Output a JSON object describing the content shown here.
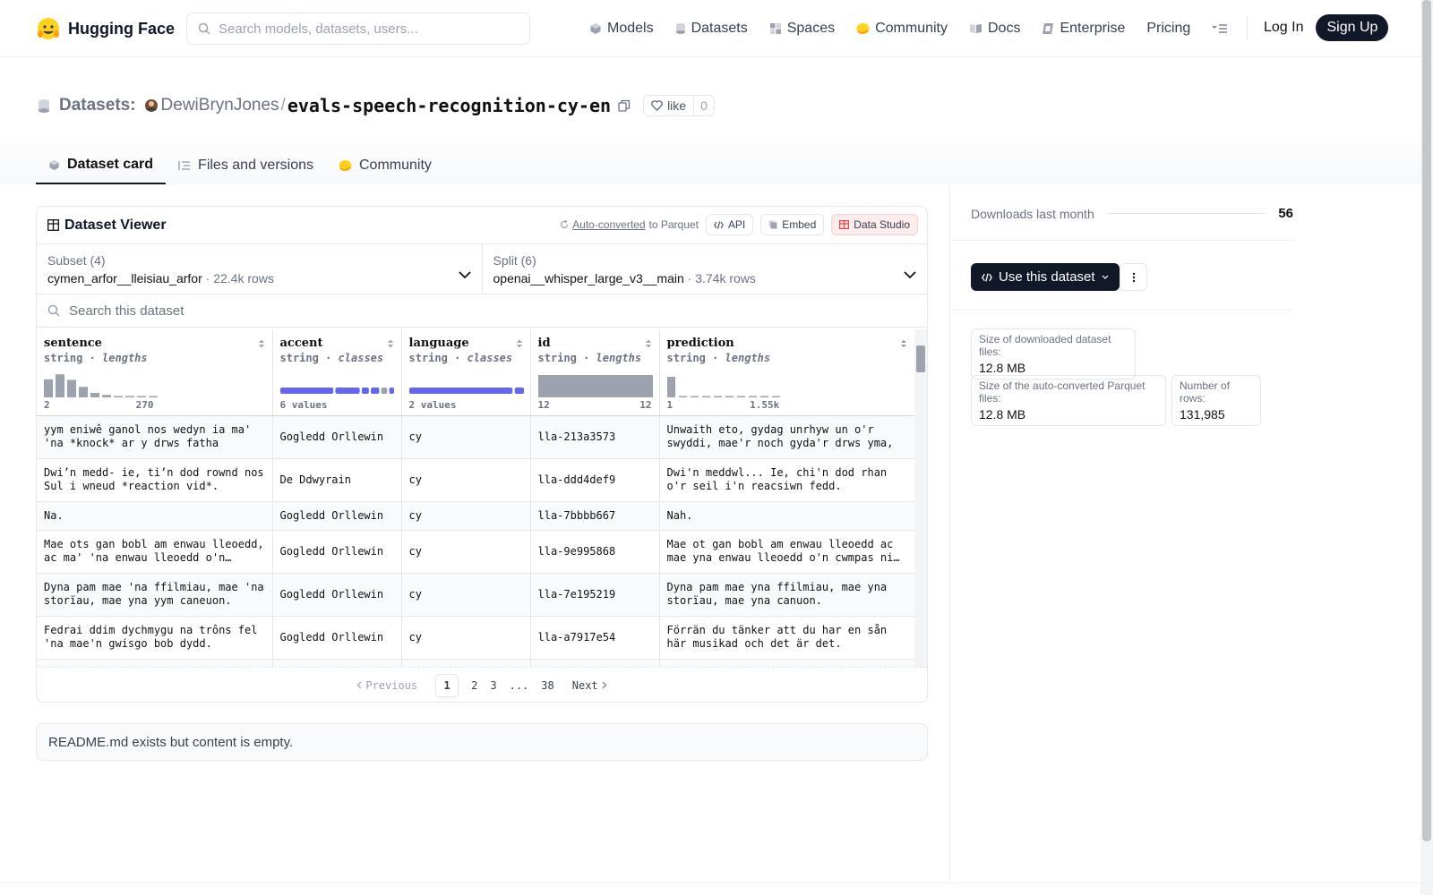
{
  "nav": {
    "brand": "Hugging Face",
    "search_placeholder": "Search models, datasets, users...",
    "links": [
      {
        "label": "Models",
        "icon": "models-icon"
      },
      {
        "label": "Datasets",
        "icon": "datasets-icon"
      },
      {
        "label": "Spaces",
        "icon": "spaces-icon"
      },
      {
        "label": "Community",
        "icon": "community-icon"
      },
      {
        "label": "Docs",
        "icon": "docs-icon"
      },
      {
        "label": "Enterprise",
        "icon": "enterprise-icon"
      },
      {
        "label": "Pricing",
        "icon": ""
      }
    ],
    "login": "Log In",
    "signup": "Sign Up"
  },
  "header": {
    "section": "Datasets:",
    "owner": "DewiBrynJones",
    "separator": "/",
    "repo": "evals-speech-recognition-cy-en",
    "like_label": "like",
    "like_count": "0",
    "tabs": [
      {
        "label": "Dataset card",
        "active": true
      },
      {
        "label": "Files and versions",
        "active": false
      },
      {
        "label": "Community",
        "active": false
      }
    ]
  },
  "viewer": {
    "title": "Dataset Viewer",
    "auto_converted": "Auto-converted",
    "to_parquet": "to Parquet",
    "api": "API",
    "embed": "Embed",
    "studio": "Data Studio",
    "subset_title": "Subset (4)",
    "subset_value": "cymen_arfor__lleisiau_arfor",
    "subset_rows": "22.4k rows",
    "split_title": "Split (6)",
    "split_value": "openai__whisper_large_v3__main",
    "split_rows": "3.74k rows",
    "search_placeholder": "Search this dataset",
    "columns": [
      {
        "name": "sentence",
        "type": "string",
        "kind": "lengths",
        "min": "2",
        "max": "270"
      },
      {
        "name": "accent",
        "type": "string",
        "kind": "classes",
        "summary": "6 values"
      },
      {
        "name": "language",
        "type": "string",
        "kind": "classes",
        "summary": "2 values"
      },
      {
        "name": "id",
        "type": "string",
        "kind": "lengths",
        "min": "12",
        "max": "12"
      },
      {
        "name": "prediction",
        "type": "string",
        "kind": "lengths",
        "min": "1",
        "max": "1.55k"
      }
    ],
    "rows": [
      [
        "yym eniwê ganol nos wedyn ia ma' 'na *knock* ar y drws fatha",
        "Gogledd Orllewin",
        "cy",
        "lla-213a3573",
        "Unwaith eto, gydag unrhyw un o'r swyddi, mae'r noch gyda'r drws yma,"
      ],
      [
        "Dwi’n medd- ie, ti’n dod rownd nos Sul i wneud *reaction vid*.",
        "De Ddwyrain",
        "cy",
        "lla-ddd4def9",
        "Dwi'n meddwl... Ie, chi'n dod rhan o'r seil i'n reacsiwn fedd."
      ],
      [
        "Na.",
        "Gogledd Orllewin",
        "cy",
        "lla-7bbbb667",
        "Nah."
      ],
      [
        "Mae ots gan bobl am enwau lleoedd, ac ma' 'na enwau lleoedd o'n cwmpas ni ym mhob man.",
        "Gogledd Orllewin",
        "cy",
        "lla-9e995868",
        "Mae ot gan bobl am enwau lleoedd ac mae yna enwau lleoedd o'n cwmpas ni ym mhob man."
      ],
      [
        "Dyna pam mae 'na ffilmiau, mae 'na storïau, mae yna yym caneuon.",
        "Gogledd Orllewin",
        "cy",
        "lla-7e195219",
        "Dyna pam mae yna ffilmiau, mae yna storïau, mae yna canuon."
      ],
      [
        "Fedrai ddim dychmygu na trôns fel 'na mae'n gwisgo bob dydd.",
        "Gogledd Orllewin",
        "cy",
        "lla-a7917e54",
        "Förrän du tänker att du har en sån här musikad och det är det."
      ],
      [
        "",
        "",
        "",
        "",
        ""
      ]
    ],
    "pagination": {
      "previous": "Previous",
      "pages": [
        "1",
        "2",
        "3",
        "...",
        "38"
      ],
      "current": "1",
      "next": "Next"
    }
  },
  "readme": "README.md exists but content is empty.",
  "sidebar": {
    "downloads_label": "Downloads last month",
    "downloads_value": "56",
    "use_button": "Use this dataset",
    "size_downloaded_label": "Size of downloaded dataset files:",
    "size_downloaded_value": "12.8 MB",
    "size_parquet_label": "Size of the auto-converted Parquet files:",
    "size_parquet_value": "12.8 MB",
    "num_rows_label": "Number of rows:",
    "num_rows_value": "131,985"
  },
  "colors": {
    "accent_bar": "#6366f1",
    "hist_gray": "#9ca3af",
    "dark": "#111827"
  }
}
